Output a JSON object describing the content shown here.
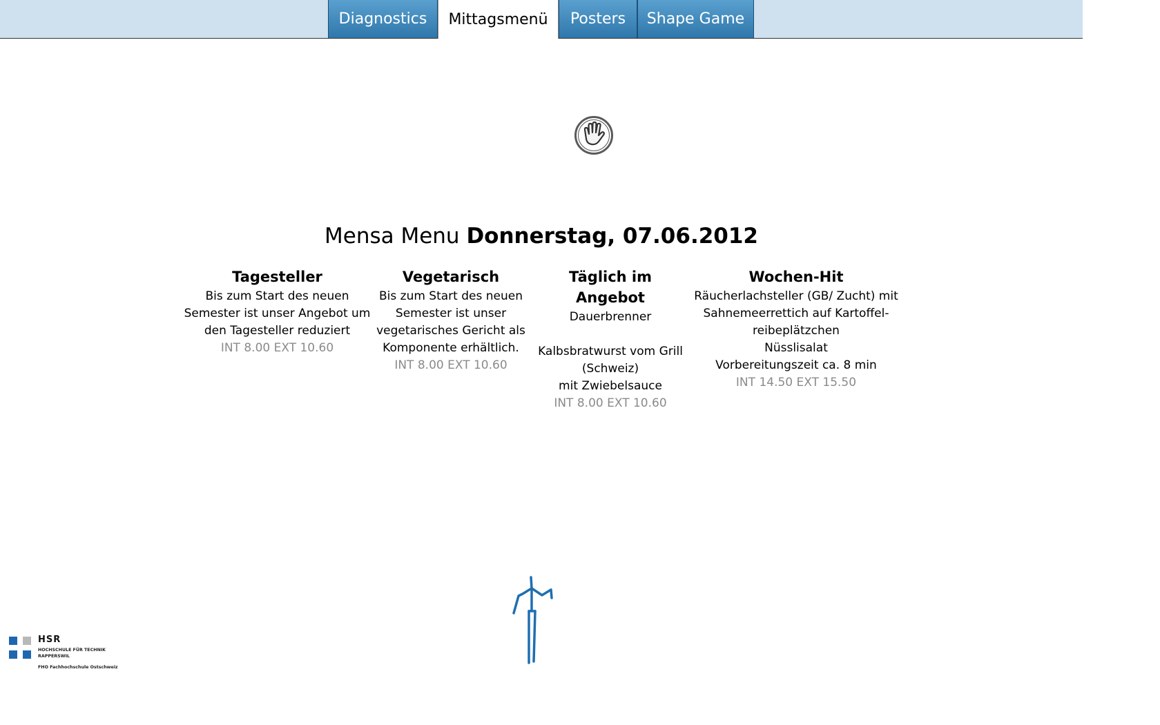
{
  "tabs": [
    {
      "label": "Diagnostics"
    },
    {
      "label": "Mittagsmenü"
    },
    {
      "label": "Posters"
    },
    {
      "label": "Shape Game"
    }
  ],
  "active_tab": "Mittagsmenü",
  "menu": {
    "heading_prefix": "Mensa Menu",
    "heading_date": "Donnerstag, 07.06.2012",
    "columns": [
      {
        "title": "Tagesteller",
        "description": "Bis zum Start des neuen\nSemester ist unser Angebot um\nden Tagesteller reduziert",
        "price": "INT 8.00 EXT 10.60"
      },
      {
        "title": "Vegetarisch",
        "description": "Bis zum Start des neuen\nSemester ist unser\nvegetarisches Gericht als\nKomponente erhältlich.",
        "price": "INT 8.00 EXT 10.60"
      },
      {
        "title": "Täglich im Angebot",
        "description": "Dauerbrenner\n\nKalbsbratwurst vom Grill\n(Schweiz)\nmit Zwiebelsauce",
        "price": "INT 8.00 EXT 10.60"
      },
      {
        "title": "Wochen-Hit",
        "description": "Räucherlachsteller (GB/ Zucht) mit\nSahnemeerrettich auf Kartoffel-\nreibeplätzchen\nNüsslisalat\nVorbereitungszeit ca. 8 min",
        "price": "INT 14.50 EXT 15.50"
      }
    ]
  },
  "logo": {
    "name": "HSR",
    "line1": "HOCHSCHULE FÜR TECHNIK",
    "line2": "RAPPERSWIL",
    "line3": "FHO Fachhochschule Ostschweiz"
  },
  "colors": {
    "topbar": "#cfe1ee",
    "tab": "#3f87bc",
    "price": "#8a8a8a",
    "skeleton": "#1e6fb0",
    "logo_blue": "#1f66b0",
    "logo_grey": "#b8b8b8"
  },
  "icons": {
    "hand_cursor": "hand-cursor-icon",
    "skeleton": "kinect-skeleton-figure"
  }
}
